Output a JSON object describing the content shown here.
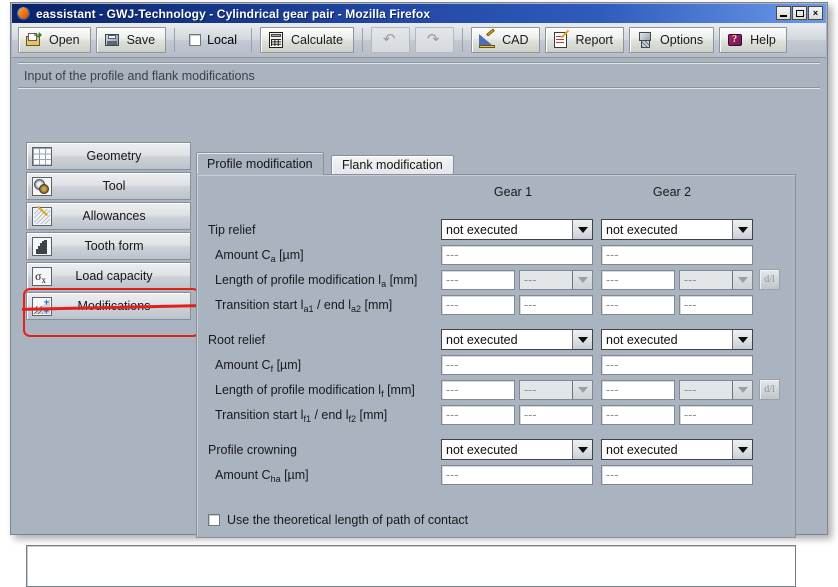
{
  "window": {
    "title": "eassistant - GWJ-Technology - Cylindrical gear pair - Mozilla Firefox",
    "app_icon": "firefox-icon",
    "controls": {
      "minimize": "minimize-icon",
      "maximize": "maximize-icon",
      "close": "×"
    }
  },
  "toolbar": {
    "open_label": "Open",
    "save_label": "Save",
    "local_label": "Local",
    "calculate_label": "Calculate",
    "undo_label": "↶",
    "redo_label": "↷",
    "cad_label": "CAD",
    "report_label": "Report",
    "options_label": "Options",
    "help_label": "Help"
  },
  "header": {
    "text": "Input of the profile and flank modifications"
  },
  "sidebar": {
    "items": [
      {
        "label": "Geometry",
        "icon": "grid-icon"
      },
      {
        "label": "Tool",
        "icon": "gears-icon"
      },
      {
        "label": "Allowances",
        "icon": "ruler-pencil-icon"
      },
      {
        "label": "Tooth form",
        "icon": "tooth-profile-icon"
      },
      {
        "label": "Load capacity",
        "icon": "sigma-stress-icon"
      },
      {
        "label": "Modifications",
        "icon": "modifications-icon"
      }
    ],
    "selected": "Modifications",
    "annotation_color": "#e3211b"
  },
  "tabs": [
    {
      "label": "Profile modification",
      "active": true
    },
    {
      "label": "Flank modification",
      "active": false
    }
  ],
  "panel": {
    "column_headers": [
      "Gear 1",
      "Gear 2"
    ],
    "empty_value": "---",
    "sections": [
      {
        "title": "Tip relief",
        "mode_gear1": "not executed",
        "mode_gear2": "not executed",
        "rows": [
          {
            "label": "Amount C",
            "sub": "a",
            "unit": "[µm]"
          },
          {
            "label": "Length of profile modification l",
            "sub": "a",
            "unit": "[mm]"
          },
          {
            "label": "Transition start l",
            "sub": "a1",
            "label2": " / end l",
            "sub2": "a2",
            "unit": "[mm]"
          }
        ]
      },
      {
        "title": "Root relief",
        "mode_gear1": "not executed",
        "mode_gear2": "not executed",
        "rows": [
          {
            "label": "Amount C",
            "sub": "f",
            "unit": "[µm]"
          },
          {
            "label": "Length of profile modification l",
            "sub": "f",
            "unit": "[mm]"
          },
          {
            "label": "Transition start l",
            "sub": "f1",
            "label2": " / end l",
            "sub2": "f2",
            "unit": "[mm]"
          }
        ]
      },
      {
        "title": "Profile crowning",
        "mode_gear1": "not executed",
        "mode_gear2": "not executed",
        "rows": [
          {
            "label": "Amount C",
            "sub": "ha",
            "unit": "[µm]"
          }
        ]
      }
    ],
    "dl_button_label": "d/l",
    "checkbox": {
      "label": "Use the theoretical length of path of contact",
      "checked": false
    }
  },
  "output": {
    "text": ""
  }
}
